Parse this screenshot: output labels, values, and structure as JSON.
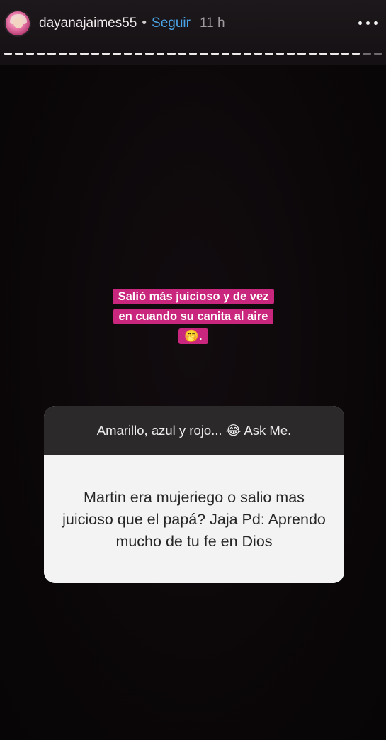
{
  "header": {
    "username": "dayanajaimes55",
    "separator": "•",
    "follow_label": "Seguir",
    "time": "11 h",
    "more_icon": "more-horizontal-icon"
  },
  "caption": {
    "text": "Salió más juicioso y de vez en cuando su canita al aire 🤭."
  },
  "ask_sticker": {
    "prompt": "Amarillo, azul y rojo... 😂 Ask Me.",
    "question": "Martin era mujeriego o salio mas juicioso que el papá? Jaja Pd: Aprendo mucho de tu fe en Dios"
  },
  "colors": {
    "caption_background": "#c9267d",
    "follow_link": "#4aa3e6",
    "background": "#0b0709"
  }
}
